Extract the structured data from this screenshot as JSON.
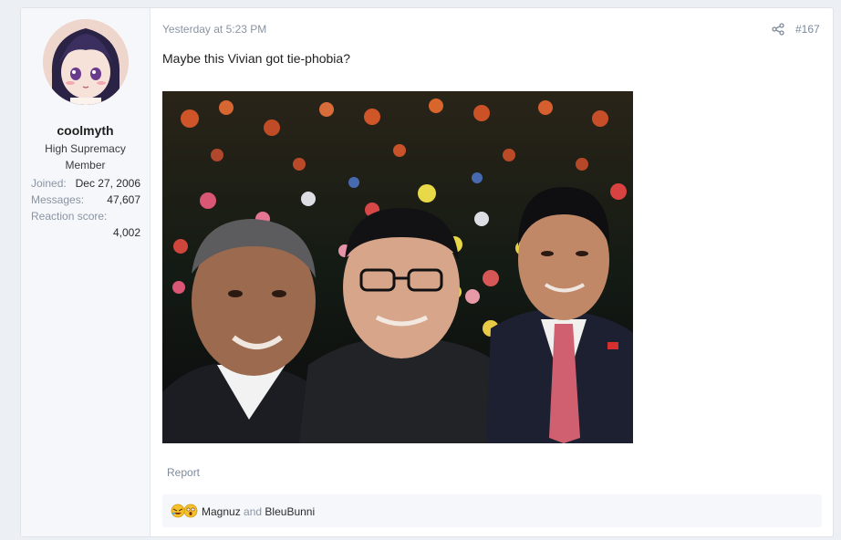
{
  "user": {
    "username": "coolmyth",
    "title": "High Supremacy Member",
    "stats": [
      {
        "key": "Joined:",
        "value": "Dec 27, 2006"
      },
      {
        "key": "Messages:",
        "value": "47,607"
      },
      {
        "key": "Reaction score:",
        "value": "4,002"
      }
    ]
  },
  "post": {
    "date": "Yesterday at 5:23 PM",
    "number": "#167",
    "message": "Maybe this Vivian got tie-phobia?",
    "report_label": "Report"
  },
  "reactions": {
    "icons": [
      "rofl-emoji",
      "astonished-emoji"
    ],
    "user1": "Magnuz",
    "joiner": "and",
    "user2": "BleuBunni"
  },
  "colors": {
    "page_bg": "#eceff3",
    "card_bg": "#ffffff",
    "muted_text": "#8a94a3",
    "user_col_bg": "#f5f7fa"
  }
}
